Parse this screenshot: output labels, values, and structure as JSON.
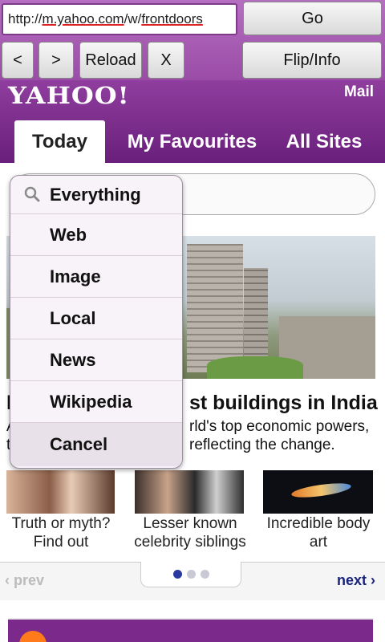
{
  "browser": {
    "url_prefix": "http://",
    "url_host": "m.yahoo.com",
    "url_sep": "/w/",
    "url_path": "frontdoors",
    "go_label": "Go",
    "back_label": "<",
    "forward_label": ">",
    "reload_label": "Reload",
    "stop_label": "X",
    "flip_label": "Flip/Info"
  },
  "header": {
    "logo": "YAHOO!",
    "mail_label": "Mail",
    "tabs": [
      "Today",
      "My Favourites",
      "All Sites"
    ]
  },
  "dropdown": {
    "items": [
      "Everything",
      "Web",
      "Image",
      "Local",
      "News",
      "Wikipedia"
    ],
    "cancel_label": "Cancel"
  },
  "story": {
    "headline_start": "I",
    "headline_end": "st buildings in India",
    "sub_line1_start": "A",
    "sub_line1_end": "rld's top economic powers,",
    "sub_line2_start": "t",
    "sub_line2_end": "reflecting the change."
  },
  "thumbs": [
    {
      "caption": "Truth or myth? Find out"
    },
    {
      "caption": "Lesser known celebrity siblings"
    },
    {
      "caption": "Incredible body art"
    }
  ],
  "pager": {
    "prev_label": "prev",
    "next_label": "next",
    "active_index": 1,
    "count": 3
  },
  "colors": {
    "chrome": "#9a4ca6",
    "brand_purple": "#6a1f7c",
    "pager_active": "#2a3aa0"
  }
}
